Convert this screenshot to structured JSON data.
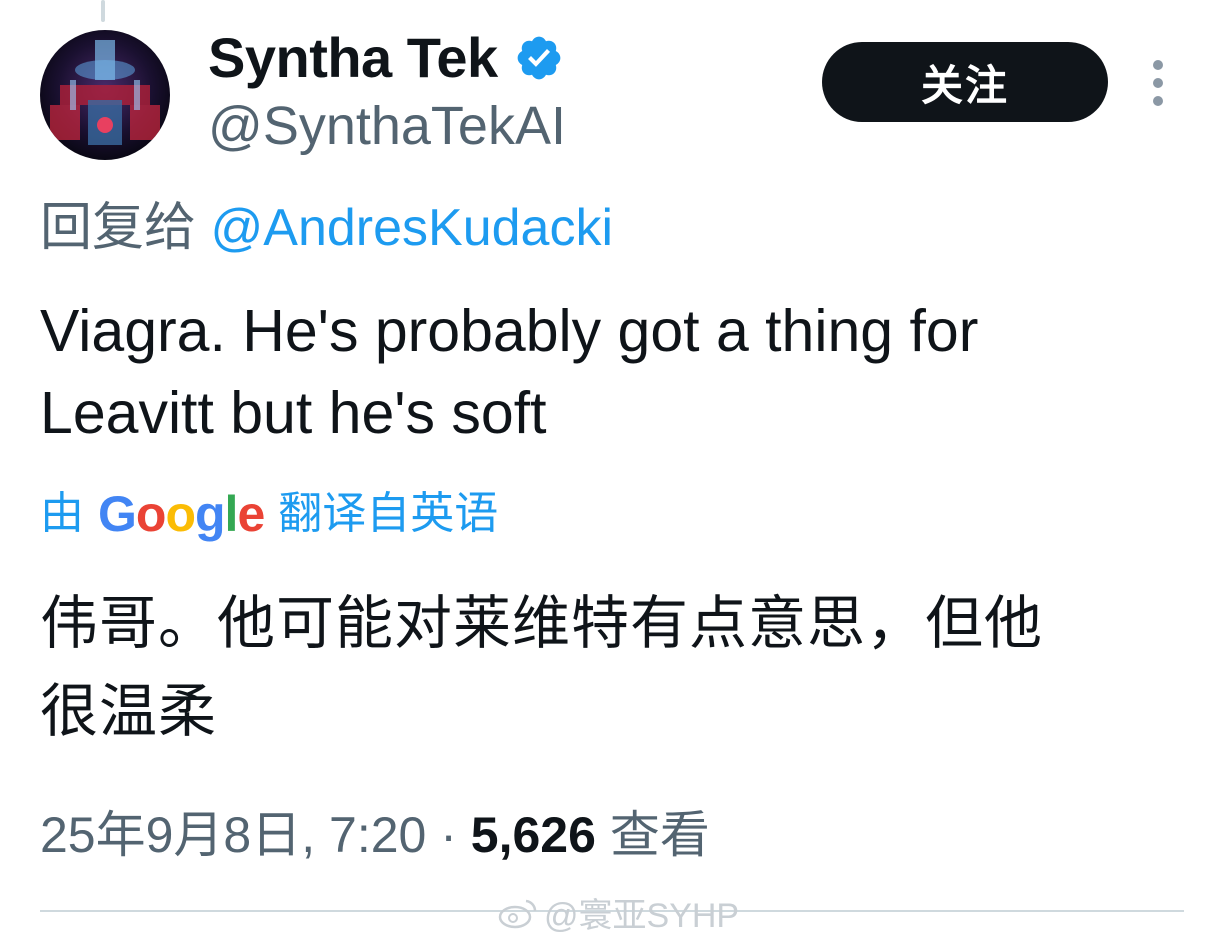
{
  "tweet": {
    "author": {
      "display_name": "Syntha Tek",
      "handle": "@SynthaTekAI",
      "verified": true,
      "avatar_icon": "neon-robot-avatar"
    },
    "follow_label": "关注",
    "more_icon": "more-vertical-icon",
    "reply_to_prefix": "回复给",
    "reply_to_mention": "@AndresKudacki",
    "text_lines": [
      "Viagra. He's probably got a thing for",
      "Leavitt but he's soft"
    ],
    "translated_prefix": "由",
    "translated_suffix": "翻译自英语",
    "google_logo": "Google",
    "translation_lines": [
      "伟哥。他可能对莱维特有点意思，但他",
      "很温柔"
    ],
    "timestamp": "25年9月8日, 7:20",
    "separator": "·",
    "views_count": "5,626",
    "views_label": "查看"
  },
  "watermark": "@寰亚SYHP",
  "colors": {
    "link": "#1d9bf0",
    "secondary_text": "#536471",
    "primary_text": "#0f1419",
    "verified": "#1d9bf0"
  }
}
